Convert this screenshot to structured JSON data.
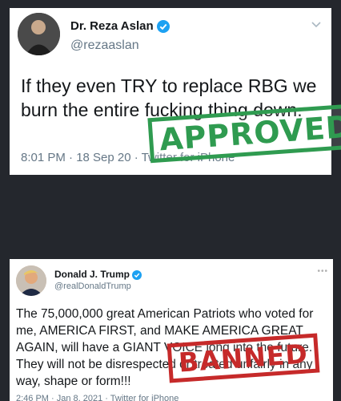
{
  "tweets": [
    {
      "display_name": "Dr. Reza Aslan",
      "handle": "@rezaaslan",
      "text": "If they even TRY to replace RBG we burn the entire fucking thing down.",
      "meta": "8:01 PM · 18 Sep 20 · Twitter for iPhone",
      "verified_icon": "verified-badge-icon",
      "menu_icon": "chevron-down-icon",
      "stamp": "APPROVED",
      "stamp_color": "#2f9b50"
    },
    {
      "display_name": "Donald J. Trump",
      "handle": "@realDonaldTrump",
      "text": "The 75,000,000 great American Patriots who voted for me, AMERICA FIRST, and MAKE AMERICA GREAT AGAIN, will have a GIANT VOICE long into the future. They will not be disrespected or treated unfairly in any way, shape or form!!!",
      "meta": "2:46 PM · Jan 8, 2021 · Twitter for iPhone",
      "verified_icon": "verified-badge-icon",
      "menu_icon": "more-dots-icon",
      "stamp": "BANNED",
      "stamp_color": "#c62a2a"
    }
  ],
  "colors": {
    "background": "#24272d",
    "card": "#ffffff",
    "verified": "#1da1f2",
    "secondary_text": "#657786"
  }
}
